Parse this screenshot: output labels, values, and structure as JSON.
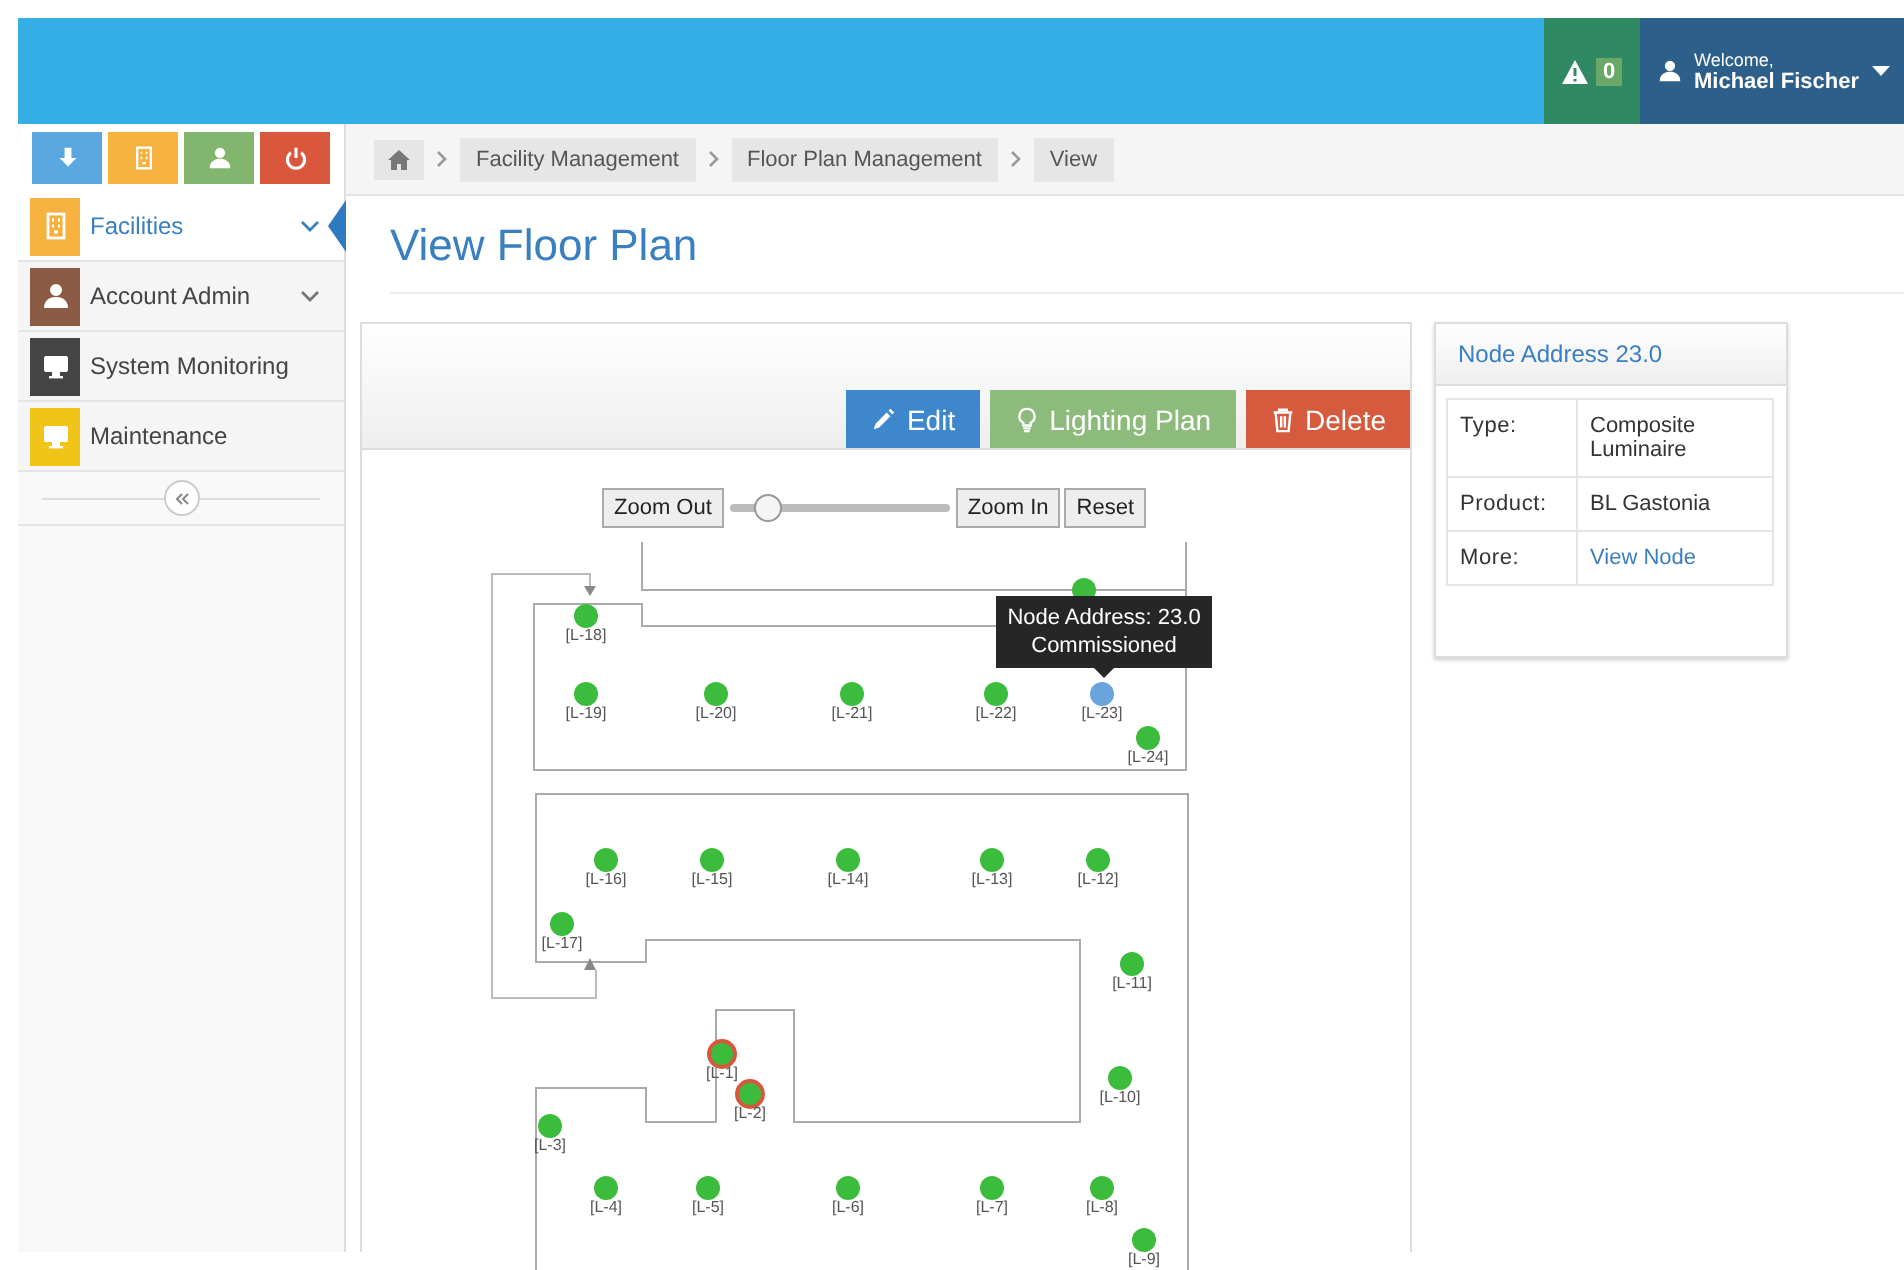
{
  "header": {
    "alerts": {
      "count": "0"
    },
    "user": {
      "greeting": "Welcome,",
      "name": "Michael Fischer"
    }
  },
  "shortcuts": [
    {
      "kind": "download",
      "color": "#5aa7e0"
    },
    {
      "kind": "building",
      "color": "#f6b13f"
    },
    {
      "kind": "user",
      "color": "#82b56e"
    },
    {
      "kind": "power",
      "color": "#d9573c"
    }
  ],
  "sidebar": {
    "items": [
      {
        "label": "Facilities",
        "kind": "building",
        "color": "#f6b13f",
        "selected": true,
        "has_submenu": true
      },
      {
        "label": "Account Admin",
        "kind": "user",
        "color": "#8a5a44",
        "selected": false,
        "has_submenu": true
      },
      {
        "label": "System Monitoring",
        "kind": "monitor",
        "color": "#444444",
        "selected": false,
        "has_submenu": false
      },
      {
        "label": "Maintenance",
        "kind": "monitor",
        "color": "#f0c419",
        "selected": false,
        "has_submenu": false
      }
    ]
  },
  "breadcrumb": [
    "Facility Management",
    "Floor Plan Management",
    "View"
  ],
  "page_title": "View Floor Plan",
  "floor_plan": {
    "actions": [
      {
        "kind": "edit",
        "label": "Edit"
      },
      {
        "kind": "lighting",
        "label": "Lighting Plan"
      },
      {
        "kind": "delete",
        "label": "Delete"
      }
    ],
    "zoom": {
      "zoom_out": "Zoom Out",
      "zoom_in": "Zoom In",
      "reset": "Reset",
      "level": 0.17
    },
    "nodes": [
      {
        "selected": false,
        "fault": false
      },
      {
        "label": "[L-18]",
        "selected": false,
        "fault": false
      },
      {
        "label": "[L-19]",
        "selected": false,
        "fault": false
      },
      {
        "label": "[L-20]",
        "selected": false,
        "fault": false
      },
      {
        "label": "[L-21]",
        "selected": false,
        "fault": false
      },
      {
        "label": "[L-22]",
        "selected": false,
        "fault": false
      },
      {
        "label": "[L-23]",
        "selected": true,
        "fault": false
      },
      {
        "label": "[L-24]",
        "selected": false,
        "fault": false
      },
      {
        "label": "[L-16]",
        "selected": false,
        "fault": false
      },
      {
        "label": "[L-15]",
        "selected": false,
        "fault": false
      },
      {
        "label": "[L-14]",
        "selected": false,
        "fault": false
      },
      {
        "label": "[L-13]",
        "selected": false,
        "fault": false
      },
      {
        "label": "[L-12]",
        "selected": false,
        "fault": false
      },
      {
        "label": "[L-17]",
        "selected": false,
        "fault": false
      },
      {
        "label": "[L-11]",
        "selected": false,
        "fault": false
      },
      {
        "label": "[L-1]",
        "selected": false,
        "fault": true
      },
      {
        "label": "[L-2]",
        "selected": false,
        "fault": true
      },
      {
        "label": "[L-10]",
        "selected": false,
        "fault": false
      },
      {
        "label": "[L-3]",
        "selected": false,
        "fault": false
      },
      {
        "label": "[L-4]",
        "selected": false,
        "fault": false
      },
      {
        "label": "[L-5]",
        "selected": false,
        "fault": false
      },
      {
        "label": "[L-6]",
        "selected": false,
        "fault": false
      },
      {
        "label": "[L-7]",
        "selected": false,
        "fault": false
      },
      {
        "label": "[L-8]",
        "selected": false,
        "fault": false
      },
      {
        "label": "[L-9]",
        "selected": false,
        "fault": false
      }
    ],
    "tooltip": {
      "lines": [
        "Node Address: 23.0",
        "Commissioned"
      ]
    }
  },
  "details": {
    "title": "Node Address 23.0",
    "rows": [
      {
        "label": "Type:",
        "value": "Composite Luminaire"
      },
      {
        "label": "Product:",
        "value": "BL Gastonia"
      },
      {
        "label": "More:",
        "value": "View Node",
        "kind": "link"
      }
    ]
  }
}
